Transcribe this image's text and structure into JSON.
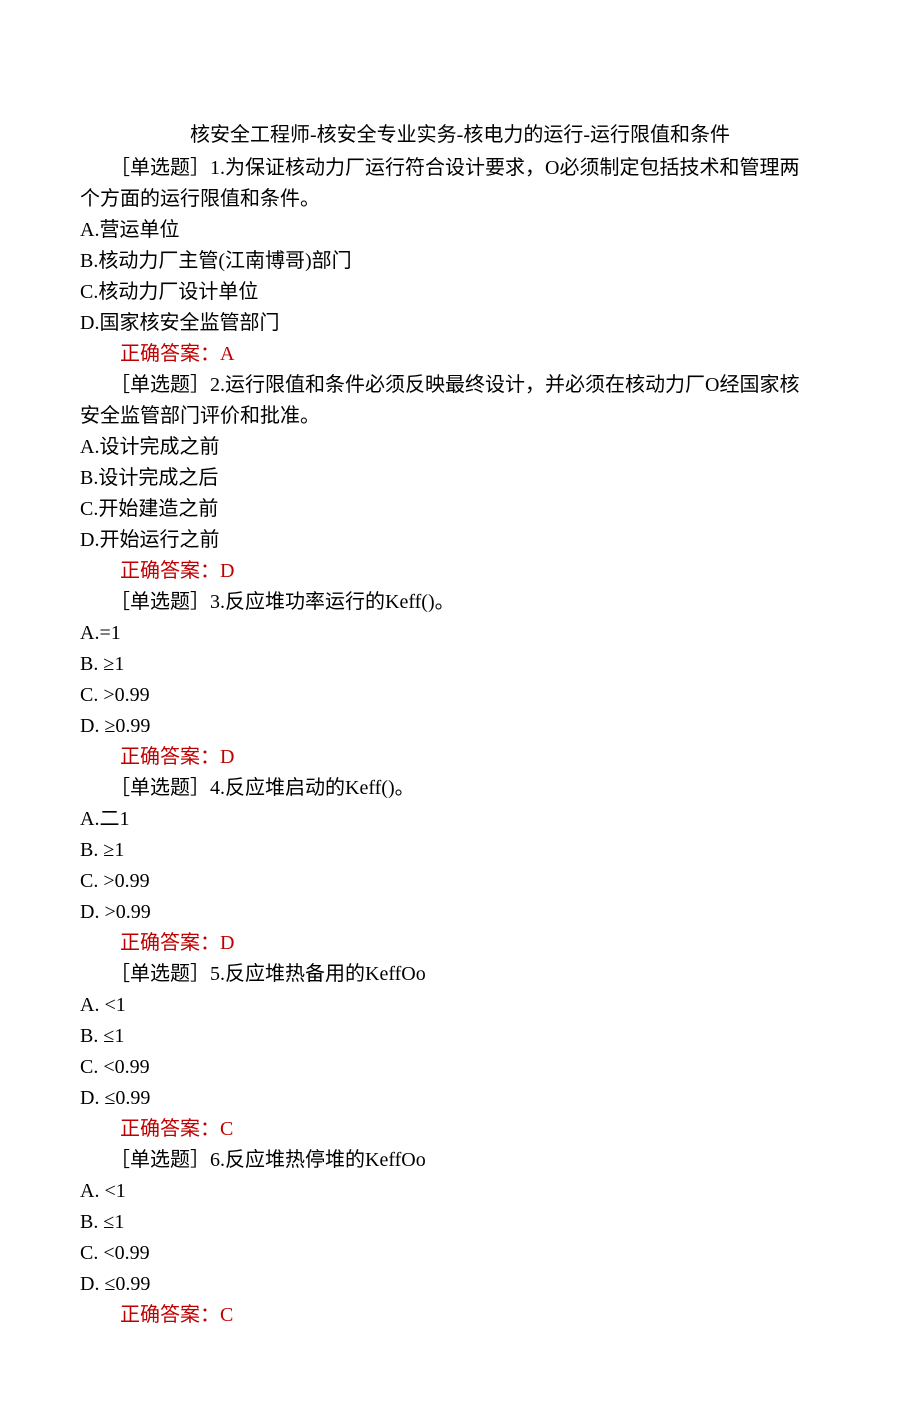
{
  "title": "核安全工程师-核安全专业实务-核电力的运行-运行限值和条件",
  "questions": [
    {
      "tag": "［单选题］",
      "num": "1.",
      "stem_lines": [
        "为保证核动力厂运行符合设计要求，O必须制定包括技术和管理两",
        "个方面的运行限值和条件。"
      ],
      "options": [
        "A.营运单位",
        "B.核动力厂主管(江南博哥)部门",
        "C.核动力厂设计单位",
        "D.国家核安全监管部门"
      ],
      "answer_label": "正确答案：",
      "answer": "A"
    },
    {
      "tag": "［单选题］",
      "num": "2.",
      "stem_lines": [
        "运行限值和条件必须反映最终设计，并必须在核动力厂O经国家核",
        "安全监管部门评价和批准。"
      ],
      "options": [
        "A.设计完成之前",
        "B.设计完成之后",
        "C.开始建造之前",
        "D.开始运行之前"
      ],
      "answer_label": "正确答案：",
      "answer": "D"
    },
    {
      "tag": "［单选题］",
      "num": "3.",
      "stem_lines": [
        "反应堆功率运行的Keff()。"
      ],
      "options": [
        "A.=1",
        "B. ≥1",
        "C. >0.99",
        "D. ≥0.99"
      ],
      "answer_label": "正确答案：",
      "answer": "D"
    },
    {
      "tag": "［单选题］",
      "num": "4.",
      "stem_lines": [
        "反应堆启动的Keff()。"
      ],
      "options": [
        "A.二1",
        "B. ≥1",
        "C. >0.99",
        "D. >0.99"
      ],
      "answer_label": "正确答案：",
      "answer": "D"
    },
    {
      "tag": "［单选题］",
      "num": "5.",
      "stem_lines": [
        "反应堆热备用的KeffOo"
      ],
      "options": [
        "A. <1",
        "B. ≤1",
        "C. <0.99",
        "D. ≤0.99"
      ],
      "answer_label": "正确答案：",
      "answer": "C"
    },
    {
      "tag": "［单选题］",
      "num": "6.",
      "stem_lines": [
        "反应堆热停堆的KeffOo"
      ],
      "options": [
        "A. <1",
        "B. ≤1",
        "C. <0.99",
        "D. ≤0.99"
      ],
      "answer_label": "正确答案：",
      "answer": "C"
    }
  ]
}
